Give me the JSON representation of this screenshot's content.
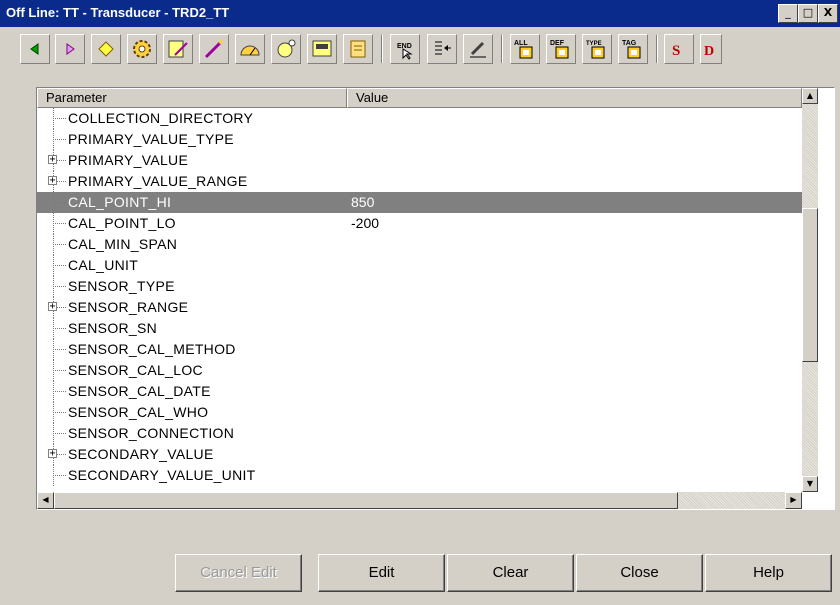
{
  "window": {
    "title": "Off Line: TT - Transducer - TRD2_TT",
    "minimize_glyph": "_",
    "maximize_glyph": "□",
    "close_glyph": "X"
  },
  "toolbar": {
    "buttons": [
      {
        "name": "back-icon"
      },
      {
        "name": "forward-icon"
      },
      {
        "name": "diamond-icon"
      },
      {
        "name": "gear-icon"
      },
      {
        "name": "device-edit-icon"
      },
      {
        "name": "calibrate-icon"
      },
      {
        "name": "gauge-icon"
      },
      {
        "name": "diagnostics-icon"
      },
      {
        "name": "display-icon"
      },
      {
        "name": "scroll-icon"
      },
      {
        "name": "end-icon",
        "label": "END"
      },
      {
        "name": "list-arrow-icon"
      },
      {
        "name": "pen-icon"
      },
      {
        "name": "all-block-icon",
        "label": "ALL"
      },
      {
        "name": "def-block-icon",
        "label": "DEF"
      },
      {
        "name": "type-block-icon",
        "label": "TYPE"
      },
      {
        "name": "tag-block-icon",
        "label": "TAG"
      },
      {
        "name": "s-red-icon",
        "label": "S"
      },
      {
        "name": "d-red-icon",
        "label": "D"
      }
    ]
  },
  "grid": {
    "columns": {
      "parameter": "Parameter",
      "value": "Value"
    },
    "rows": [
      {
        "name": "COLLECTION_DIRECTORY",
        "value": "",
        "expandable": false,
        "selected": false
      },
      {
        "name": "PRIMARY_VALUE_TYPE",
        "value": "",
        "expandable": false,
        "selected": false
      },
      {
        "name": "PRIMARY_VALUE",
        "value": "",
        "expandable": true,
        "selected": false
      },
      {
        "name": "PRIMARY_VALUE_RANGE",
        "value": "",
        "expandable": true,
        "selected": false
      },
      {
        "name": "CAL_POINT_HI",
        "value": "850",
        "expandable": false,
        "selected": true
      },
      {
        "name": "CAL_POINT_LO",
        "value": "-200",
        "expandable": false,
        "selected": false
      },
      {
        "name": "CAL_MIN_SPAN",
        "value": "",
        "expandable": false,
        "selected": false
      },
      {
        "name": "CAL_UNIT",
        "value": "",
        "expandable": false,
        "selected": false
      },
      {
        "name": "SENSOR_TYPE",
        "value": "",
        "expandable": false,
        "selected": false
      },
      {
        "name": "SENSOR_RANGE",
        "value": "",
        "expandable": true,
        "selected": false
      },
      {
        "name": "SENSOR_SN",
        "value": "",
        "expandable": false,
        "selected": false
      },
      {
        "name": "SENSOR_CAL_METHOD",
        "value": "",
        "expandable": false,
        "selected": false
      },
      {
        "name": "SENSOR_CAL_LOC",
        "value": "",
        "expandable": false,
        "selected": false
      },
      {
        "name": "SENSOR_CAL_DATE",
        "value": "",
        "expandable": false,
        "selected": false
      },
      {
        "name": "SENSOR_CAL_WHO",
        "value": "",
        "expandable": false,
        "selected": false
      },
      {
        "name": "SENSOR_CONNECTION",
        "value": "",
        "expandable": false,
        "selected": false
      },
      {
        "name": "SECONDARY_VALUE",
        "value": "",
        "expandable": true,
        "selected": false
      },
      {
        "name": "SECONDARY_VALUE_UNIT",
        "value": "",
        "expandable": false,
        "selected": false
      }
    ],
    "expand_glyph": "+"
  },
  "buttons": {
    "cancel_edit": "Cancel Edit",
    "edit": "Edit",
    "clear": "Clear",
    "close": "Close",
    "help": "Help"
  },
  "colors": {
    "title_bar": "#0a2a8c",
    "selection": "#808080",
    "face": "#d4d0c8"
  }
}
